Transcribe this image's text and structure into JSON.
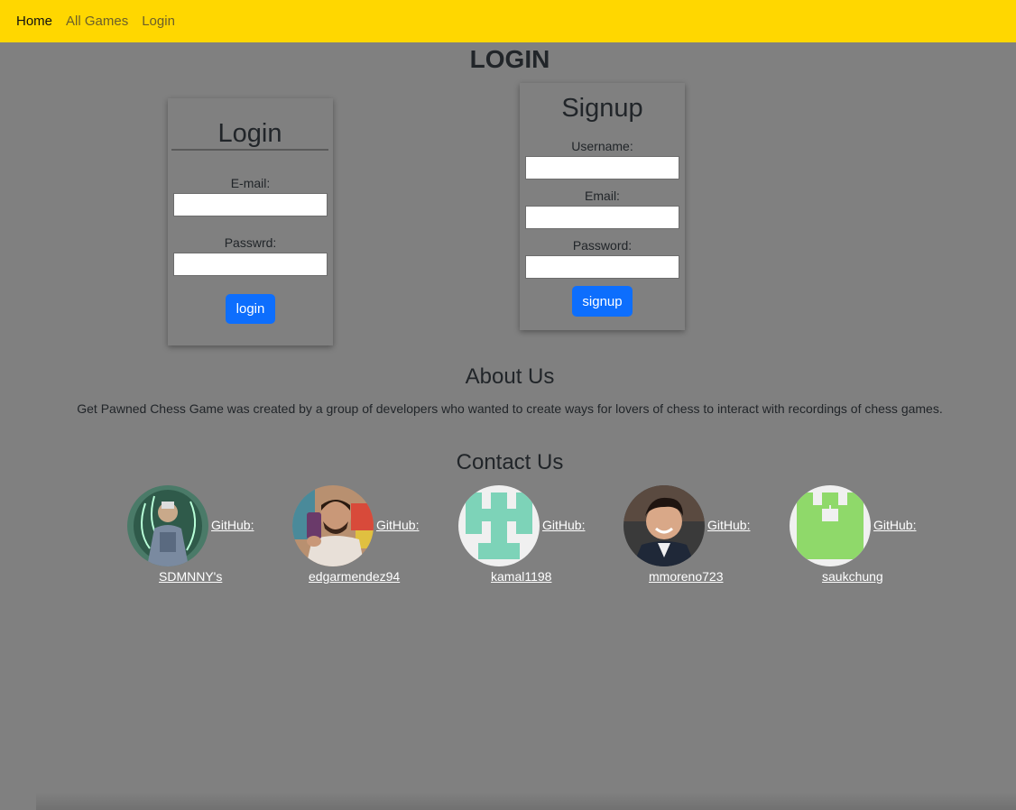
{
  "nav": {
    "links": [
      {
        "label": "Home"
      },
      {
        "label": "All Games"
      },
      {
        "label": "Login"
      }
    ]
  },
  "page": {
    "title": "LOGIN"
  },
  "login_form": {
    "title": "Login",
    "email_label": "E-mail:",
    "email_value": "",
    "password_label": "Passwrd:",
    "password_value": "",
    "submit_label": "login"
  },
  "signup_form": {
    "title": "Signup",
    "username_label": "Username:",
    "username_value": "",
    "email_label": "Email:",
    "email_value": "",
    "password_label": "Password:",
    "password_value": "",
    "submit_label": "signup"
  },
  "about": {
    "title": "About Us",
    "text": "Get Pawned Chess Game was created by a group of developers who wanted to create ways for lovers of chess to interact with recordings of chess games."
  },
  "contact": {
    "title": "Contact Us",
    "members": [
      {
        "github_label": "GitHub:",
        "username": "SDMNNY's",
        "avatar": "illustrated-character"
      },
      {
        "github_label": "GitHub:",
        "username": "edgarmendez94",
        "avatar": "photo-selfie"
      },
      {
        "github_label": "GitHub:",
        "username": "kamal1198",
        "avatar": "identicon-teal",
        "avatar_color": "#7dd3b8"
      },
      {
        "github_label": "GitHub:",
        "username": "mmoreno723",
        "avatar": "photo-portrait"
      },
      {
        "github_label": "GitHub:",
        "username": "saukchung",
        "avatar": "identicon-green",
        "avatar_color": "#8fd96a"
      }
    ]
  },
  "colors": {
    "navbar": "#ffd700",
    "background": "#808080",
    "button": "#0d6efd"
  }
}
